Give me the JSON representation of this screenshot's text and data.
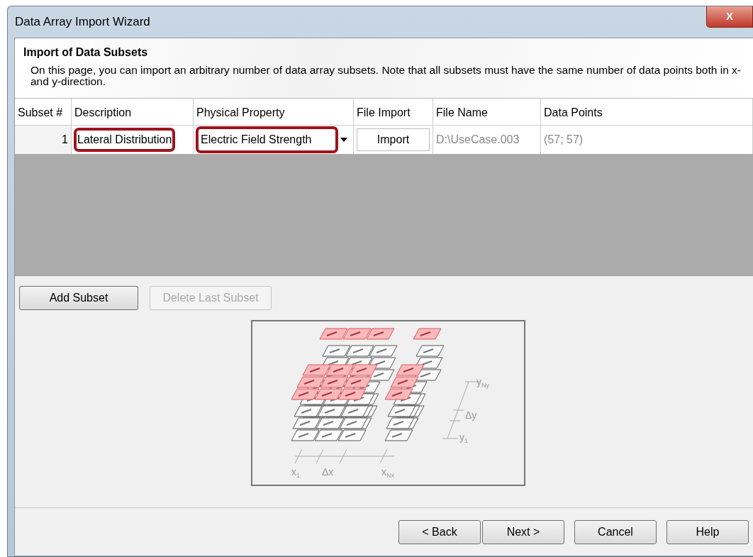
{
  "window": {
    "title": "Data Array Import Wizard",
    "close_label": "X"
  },
  "header": {
    "title": "Import of Data Subsets",
    "description": "On this page, you can import an arbitrary number of data array subsets. Note that all subsets must have the same number of data points both in x- and y-direction."
  },
  "table": {
    "columns": [
      "Subset #",
      "Description",
      "Physical Property",
      "File Import",
      "File Name",
      "Data Points"
    ],
    "rows": [
      {
        "cells": [
          {
            "kind": "number",
            "text": "1",
            "highlighted": false
          },
          {
            "kind": "text",
            "text": "Lateral Distribution",
            "highlighted": true
          },
          {
            "kind": "dropdown",
            "text": "Electric Field Strength",
            "highlighted": true
          },
          {
            "kind": "button",
            "text": "Import",
            "highlighted": false
          },
          {
            "kind": "readonly",
            "text": "D:\\UseCase.003",
            "highlighted": false
          },
          {
            "kind": "readonly",
            "text": "(57; 57)",
            "highlighted": false
          }
        ]
      }
    ]
  },
  "subset_buttons": [
    {
      "label": "Add Subset",
      "disabled": false
    },
    {
      "label": "Delete Last Subset",
      "disabled": true
    }
  ],
  "diagram": {
    "labels": [
      "y$_{Ny}$",
      "Δy",
      "y$_{1}$",
      "x$_{1}$",
      "Δx",
      "x$_{Nx}$"
    ]
  },
  "footer_buttons": [
    {
      "label": "< Back",
      "disabled": false
    },
    {
      "label": "Next >",
      "disabled": false
    },
    {
      "label": "Cancel",
      "disabled": false
    },
    {
      "label": "Help",
      "disabled": false
    }
  ]
}
